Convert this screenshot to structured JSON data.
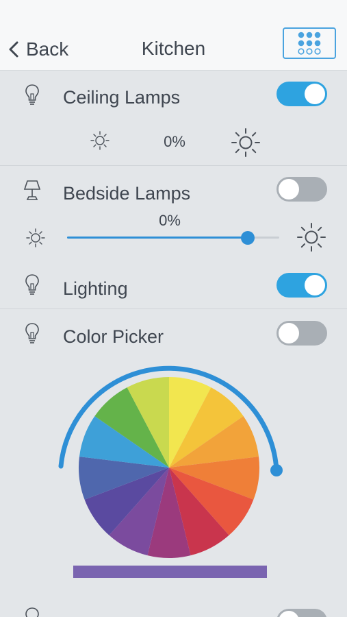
{
  "navbar": {
    "back_label": "Back",
    "title": "Kitchen",
    "grid_icon": "dots-grid-icon"
  },
  "rows": [
    {
      "label": "Ceiling Lamps",
      "icon": "bulb-icon",
      "toggle_on": true,
      "percent": "0%"
    },
    {
      "label": "Bedside Lamps",
      "icon": "lamp-icon",
      "toggle_on": false,
      "percent": "0%",
      "slider_level": 0.85
    },
    {
      "label": "Lighting",
      "icon": "bulb-icon",
      "toggle_on": true
    },
    {
      "label": "Color Picker",
      "icon": "bulb-icon",
      "toggle_on": false,
      "selected_color": "#7a64b0"
    }
  ],
  "colors": {
    "accent": "#2ea3e0",
    "wheel": [
      "#f2e64f",
      "#f4c43a",
      "#f2a33a",
      "#ef7f38",
      "#e9573f",
      "#c9354d",
      "#9b3a7d",
      "#7b4b9e",
      "#5a4aa0",
      "#4f67ad",
      "#3ea0d8",
      "#64b34a",
      "#c9d94f"
    ]
  }
}
